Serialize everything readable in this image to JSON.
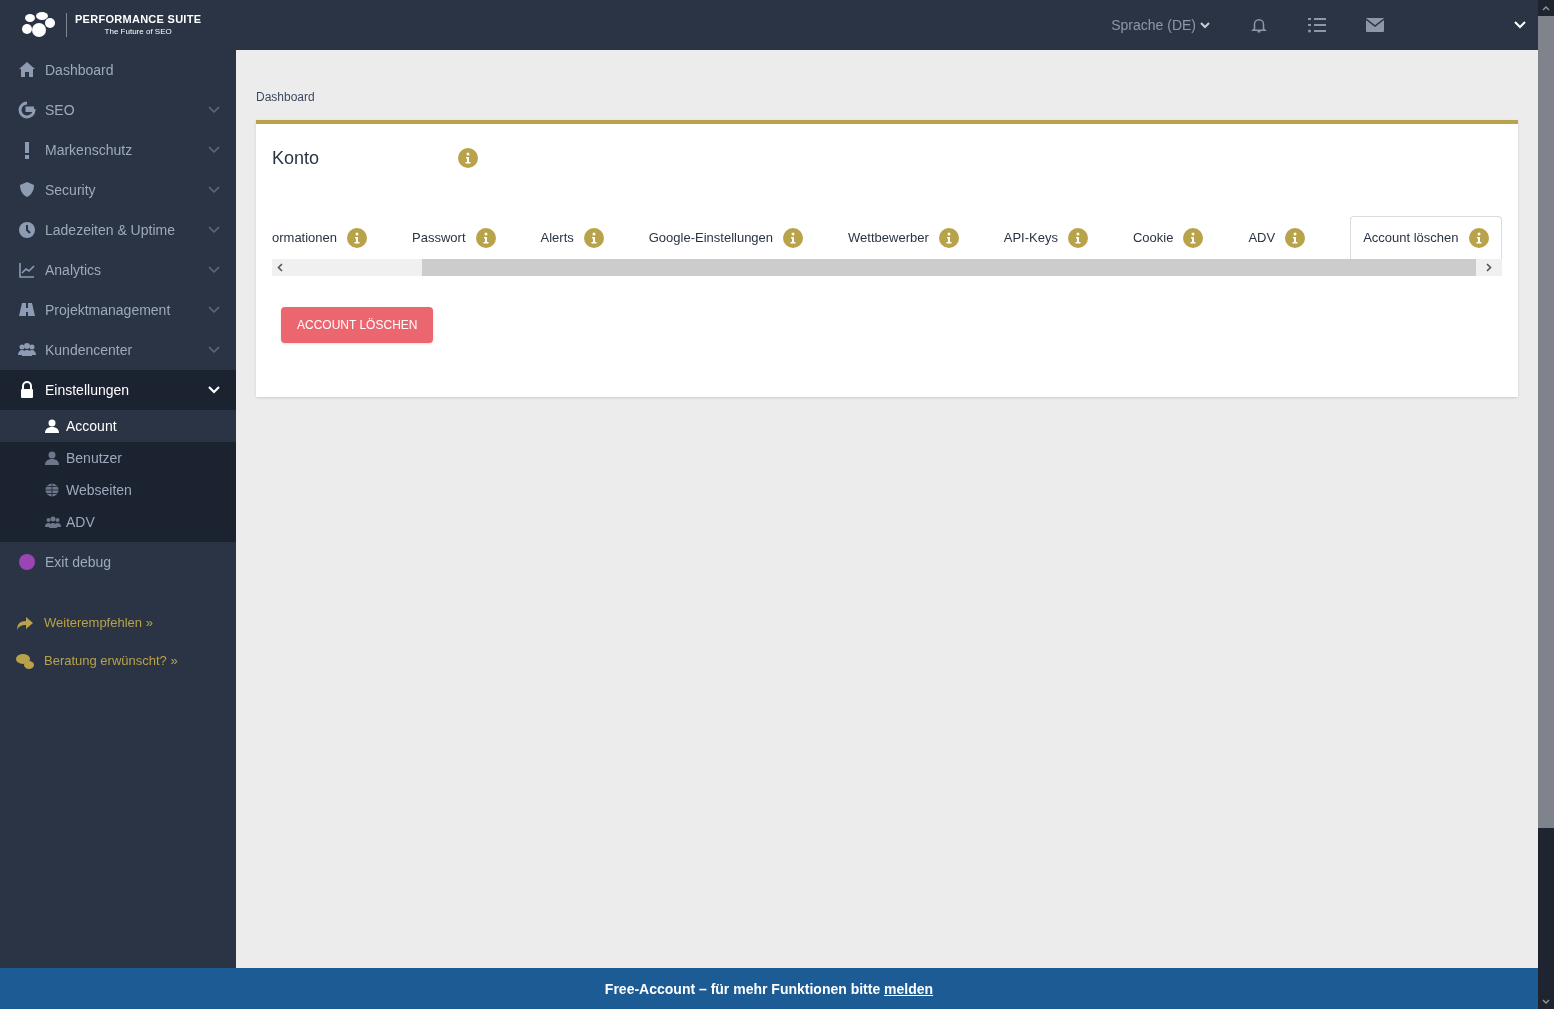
{
  "brand": {
    "name": "PERFORMANCE SUITE",
    "tagline": "The Future of SEO"
  },
  "topbar": {
    "language": "Sprache (DE)"
  },
  "sidebar": {
    "items": [
      {
        "kind": "link",
        "label": "Dashboard"
      },
      {
        "kind": "menu",
        "label": "SEO",
        "expanded": false
      },
      {
        "kind": "menu",
        "label": "Markenschutz",
        "expanded": false
      },
      {
        "kind": "menu",
        "label": "Security",
        "expanded": false
      },
      {
        "kind": "menu",
        "label": "Ladezeiten & Uptime",
        "expanded": false
      },
      {
        "kind": "menu",
        "label": "Analytics",
        "expanded": false
      },
      {
        "kind": "menu",
        "label": "Projektmanagement",
        "expanded": false
      },
      {
        "kind": "menu",
        "label": "Kundencenter",
        "expanded": false
      },
      {
        "kind": "menu",
        "label": "Einstellungen",
        "expanded": true,
        "children": [
          {
            "label": "Account",
            "selected": true
          },
          {
            "label": "Benutzer",
            "selected": false
          },
          {
            "label": "Webseiten",
            "selected": false
          },
          {
            "label": "ADV",
            "selected": false
          }
        ]
      },
      {
        "kind": "link",
        "label": "Exit debug"
      }
    ],
    "extra_links": [
      "Weiterempfehlen »",
      "Beratung erwünscht? »"
    ]
  },
  "breadcrumb": "Dashboard",
  "card": {
    "title": "Konto",
    "tabs": [
      {
        "label": "ormationen",
        "selected": false
      },
      {
        "label": "Passwort",
        "selected": false
      },
      {
        "label": "Alerts",
        "selected": false
      },
      {
        "label": "Google-Einstellungen",
        "selected": false
      },
      {
        "label": "Wettbewerber",
        "selected": false
      },
      {
        "label": "API-Keys",
        "selected": false
      },
      {
        "label": "Cookie",
        "selected": false
      },
      {
        "label": "ADV",
        "selected": false
      },
      {
        "label": "Account löschen",
        "selected": true
      }
    ],
    "button": "ACCOUNT LÖSCHEN"
  },
  "footer": {
    "text": "Free-Account – für mehr Funktionen bitte",
    "link": "melden"
  }
}
